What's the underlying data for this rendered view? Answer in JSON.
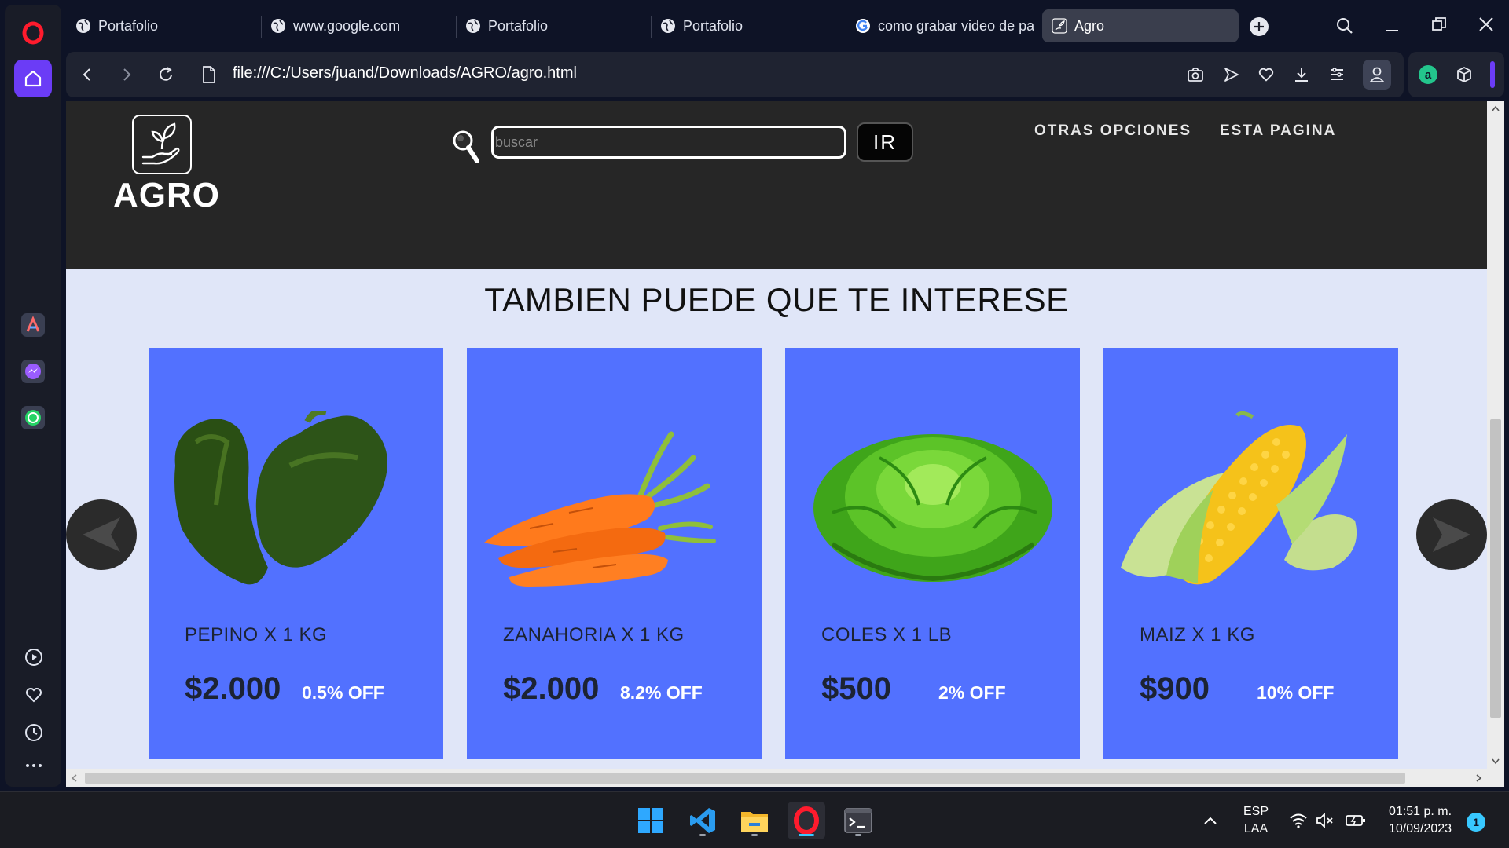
{
  "browser": {
    "tabs": [
      {
        "label": "Portafolio",
        "icon": "globe-icon"
      },
      {
        "label": "www.google.com",
        "icon": "globe-icon"
      },
      {
        "label": "Portafolio",
        "icon": "globe-icon"
      },
      {
        "label": "Portafolio",
        "icon": "globe-icon"
      },
      {
        "label": "como grabar video de pa",
        "icon": "google-icon"
      },
      {
        "label": "Agro",
        "icon": "plant-icon"
      }
    ],
    "active_tab": 5,
    "address": "file:///C:/Users/juand/Downloads/AGRO/agro.html"
  },
  "site": {
    "logo_text": "AGRO",
    "search_placeholder": "buscar",
    "search_button": "IR",
    "nav": [
      "OTRAS OPCIONES",
      "ESTA PAGINA"
    ],
    "section_title": "TAMBIEN PUEDE QUE TE INTERESE",
    "products": [
      {
        "name": "PEPINO X 1 KG",
        "price": "$2.000",
        "discount": "0.5% OFF",
        "image": "green-pepper"
      },
      {
        "name": "ZANAHORIA X 1 KG",
        "price": "$2.000",
        "discount": "8.2% OFF",
        "image": "carrots"
      },
      {
        "name": "COLES X 1 LB",
        "price": "$500",
        "discount": "2% OFF",
        "image": "lettuce"
      },
      {
        "name": "MAIZ X 1 KG",
        "price": "$900",
        "discount": "10% OFF",
        "image": "corn"
      }
    ]
  },
  "taskbar": {
    "lang_line1": "ESP",
    "lang_line2": "LAA",
    "time": "01:51 p. m.",
    "date": "10/09/2023",
    "notification_count": "1"
  },
  "colors": {
    "card_bg": "#5271ff",
    "header_bg": "#262626",
    "page_bg": "#e0e6f8",
    "opera_red": "#ff1b2d",
    "home_purple": "#6b3cf6"
  }
}
